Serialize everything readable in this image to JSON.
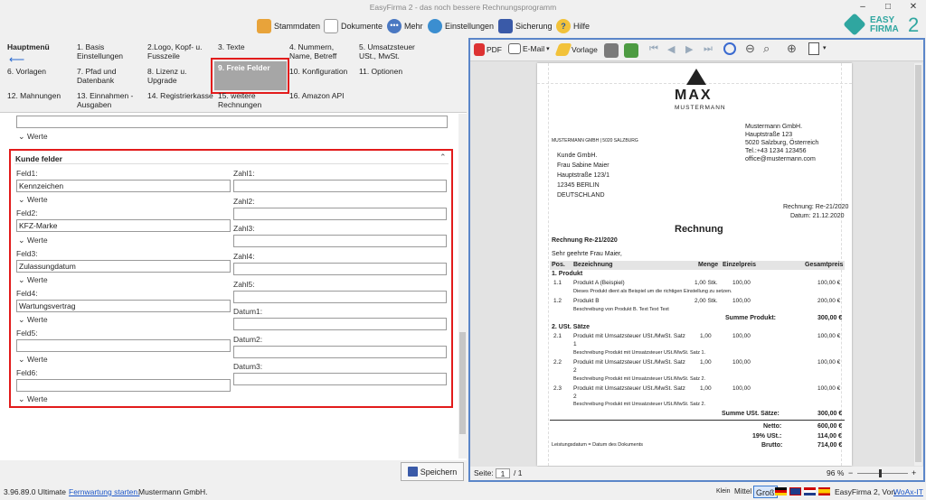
{
  "window": {
    "title": "EasyFirma 2 - das noch bessere Rechnungsprogramm"
  },
  "toolbar": {
    "stammdaten": "Stammdaten",
    "dokumente": "Dokumente",
    "mehr": "Mehr",
    "einstellungen": "Einstellungen",
    "sicherung": "Sicherung",
    "hilfe": "Hilfe"
  },
  "logo": {
    "line1": "EASY",
    "line2": "FIRMA",
    "num": "2"
  },
  "nav": {
    "hauptmenu": "Hauptmenü",
    "items": [
      "1. Basis Einstellungen",
      "2.Logo, Kopf- u. Fusszeile",
      "3. Texte",
      "4. Nummern, Name, Betreff",
      "5. Umsatzsteuer USt., MwSt.",
      "6. Vorlagen",
      "7. Pfad und Datenbank",
      "8. Lizenz u. Upgrade",
      "9. Freie Felder",
      "10. Konfiguration",
      "11. Optionen",
      "12. Mahnungen",
      "13. Einnahmen - Ausgaben",
      "14. Registrierkasse",
      "15. weitere Rechnungen",
      "16. Amazon API"
    ]
  },
  "form": {
    "werte": "Werte",
    "group_title": "Kunde felder",
    "feld_labels": [
      "Feld1:",
      "Feld2:",
      "Feld3:",
      "Feld4:",
      "Feld5:",
      "Feld6:"
    ],
    "feld_values": [
      "Kennzeichen",
      "KFZ-Marke",
      "Zulassungdatum",
      "Wartungsvertrag",
      "",
      ""
    ],
    "zahl_labels": [
      "Zahl1:",
      "Zahl2:",
      "Zahl3:",
      "Zahl4:",
      "Zahl5:"
    ],
    "datum_labels": [
      "Datum1:",
      "Datum2:",
      "Datum3:"
    ],
    "save": "Speichern"
  },
  "status": {
    "version": "3.96.89.0 Ultimate",
    "link": "Fernwartung starten.",
    "company": "Mustermann GmbH.",
    "sizes": [
      "Klein",
      "Mittel",
      "Groß"
    ],
    "right": "EasyFirma 2, Von",
    "right_link": "WoAx-IT"
  },
  "preview": {
    "tb": {
      "pdf": "PDF",
      "email": "E-Mail",
      "vorlage": "Vorlage"
    },
    "page_label": "Seite:",
    "page_num": "1",
    "page_total": "/ 1",
    "zoom": "96 %",
    "logo_text": "MAX",
    "logo_sub": "MUSTERMANN",
    "sender": [
      "Mustermann GmbH.",
      "Hauptstraße 123",
      "5020 Salzburg, Österreich",
      "Tel.:+43 1234 123456",
      "office@mustermann.com"
    ],
    "sender_line": "MUSTERMANN GMBH | 5020 SALZBURG",
    "recipient": [
      "Kunde GmbH.",
      "Frau Sabine Maier",
      "Hauptstraße 123/1",
      "12345 BERLIN",
      "DEUTSCHLAND"
    ],
    "rechnung_nr": "Rechnung: Re-21/2020",
    "datum": "Datum: 21.12.2020",
    "heading": "Rechnung",
    "betreff": "Rechnung Re-21/2020",
    "anrede": "Sehr geehrte Frau Maier,",
    "columns": [
      "Pos.",
      "Bezeichnung",
      "Menge",
      "Einzelpreis",
      "Gesamtpreis"
    ],
    "sec1": "1. Produkt",
    "rows1": [
      {
        "pos": "1.1",
        "name": "Produkt A (Beispiel)",
        "menge": "1,00 Stk.",
        "ep": "100,00",
        "gp": "100,00 €",
        "desc": "Dieses Produkt dient als Beispiel um die richtigen Einstellung zu setzen."
      },
      {
        "pos": "1.2",
        "name": "Produkt B",
        "menge": "2,00 Stk.",
        "ep": "100,00",
        "gp": "200,00 €",
        "desc": "Beschreibung von Produkt B. Text Text Text"
      }
    ],
    "sum1_label": "Summe Produkt:",
    "sum1": "300,00 €",
    "sec2": "2. USt. Sätze",
    "rows2": [
      {
        "pos": "2.1",
        "name": "Produkt mit Umsatzsteuer USt./MwSt. Satz",
        "n2": "1",
        "menge": "1,00",
        "ep": "100,00",
        "gp": "100,00 €",
        "desc": "Beschreibung Produkt mit Umsatzsteuer USt./MwSt. Satz 1."
      },
      {
        "pos": "2.2",
        "name": "Produkt mit Umsatzsteuer USt./MwSt. Satz",
        "n2": "2",
        "menge": "1,00",
        "ep": "100,00",
        "gp": "100,00 €",
        "desc": "Beschreibung Produkt mit Umsatzsteuer USt./MwSt. Satz 2."
      },
      {
        "pos": "2.3",
        "name": "Produkt mit Umsatzsteuer USt./MwSt. Satz",
        "n2": "2",
        "menge": "1,00",
        "ep": "100,00",
        "gp": "100,00 €",
        "desc": "Beschreibung Produkt mit Umsatzsteuer USt./MwSt. Satz 2."
      }
    ],
    "sum2_label": "Summe USt. Sätze:",
    "sum2": "300,00 €",
    "totals": [
      {
        "label": "Netto:",
        "value": "600,00 €"
      },
      {
        "label": "19% USt.:",
        "value": "114,00 €"
      },
      {
        "label": "Brutto:",
        "value": "714,00 €"
      }
    ],
    "leistung": "Leistungsdatum = Datum des Dokuments"
  }
}
